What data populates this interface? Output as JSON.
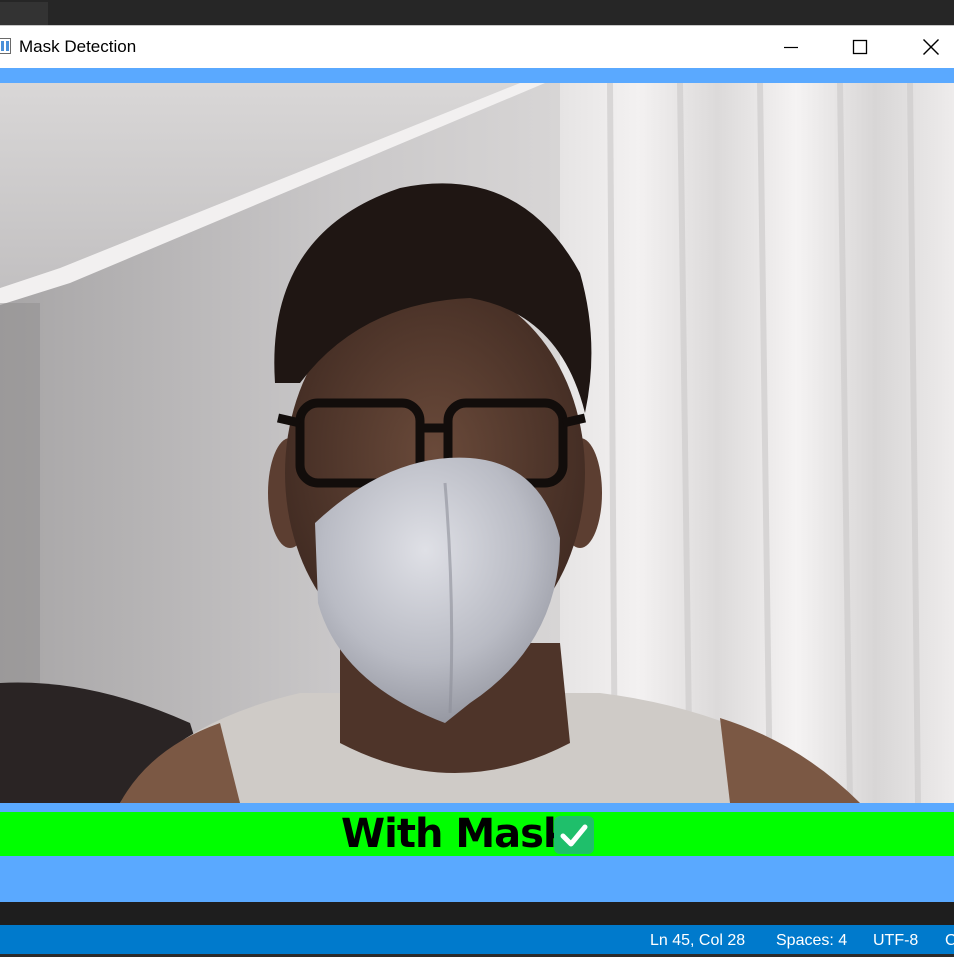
{
  "window": {
    "title": "Mask Detection"
  },
  "status_banner": {
    "label": "With Mask",
    "background_color": "#00ff00",
    "icon": "check-mark-icon"
  },
  "video": {
    "content": "webcam-feed"
  },
  "editor_statusbar": {
    "position": "Ln 45, Col 28",
    "indent": "Spaces: 4",
    "encoding": "UTF-8",
    "overflow": "C"
  },
  "colors": {
    "window_body": "#5aa9ff",
    "banner": "#00ff00",
    "statusbar": "#007acc"
  }
}
